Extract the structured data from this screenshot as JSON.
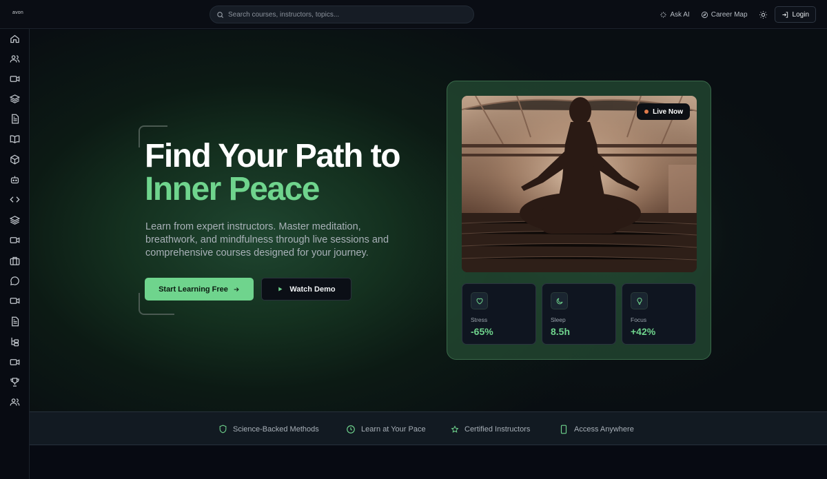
{
  "app": {
    "logo": "avon"
  },
  "search": {
    "placeholder": "Search courses, instructors, topics..."
  },
  "topnav": {
    "ask_ai": "Ask AI",
    "career_map": "Career Map",
    "login": "Login"
  },
  "sidebar": {
    "items": [
      {
        "icon": "home-icon"
      },
      {
        "icon": "users-icon"
      },
      {
        "icon": "video-icon"
      },
      {
        "icon": "layers-icon"
      },
      {
        "icon": "document-icon"
      },
      {
        "icon": "book-icon"
      },
      {
        "icon": "box-icon"
      },
      {
        "icon": "bot-icon"
      },
      {
        "icon": "code-icon"
      },
      {
        "icon": "layers-icon"
      },
      {
        "icon": "video-icon"
      },
      {
        "icon": "briefcase-icon"
      },
      {
        "icon": "chat-icon"
      },
      {
        "icon": "video-icon"
      },
      {
        "icon": "document-icon"
      },
      {
        "icon": "hierarchy-icon"
      },
      {
        "icon": "video-icon"
      },
      {
        "icon": "trophy-icon"
      },
      {
        "icon": "users-icon"
      }
    ]
  },
  "hero": {
    "title_line1": "Find Your Path to",
    "title_line2": "Inner Peace",
    "description": "Learn from expert instructors. Master meditation, breathwork, and mindfulness through live sessions and comprehensive courses designed for your journey.",
    "primary_cta": "Start Learning Free",
    "secondary_cta": "Watch Demo"
  },
  "card": {
    "badge": "Live Now",
    "stats": [
      {
        "icon": "heart-icon",
        "label": "Stress",
        "value": "-65%"
      },
      {
        "icon": "moon-icon",
        "label": "Sleep",
        "value": "8.5h"
      },
      {
        "icon": "lightbulb-icon",
        "label": "Focus",
        "value": "+42%"
      }
    ]
  },
  "features": [
    {
      "icon": "shield-icon",
      "label": "Science-Backed Methods"
    },
    {
      "icon": "clock-icon",
      "label": "Learn at Your Pace"
    },
    {
      "icon": "star-icon",
      "label": "Certified Instructors"
    },
    {
      "icon": "phone-icon",
      "label": "Access Anywhere"
    }
  ],
  "colors": {
    "accent": "#6fd48d",
    "background": "#070a12",
    "live_dot": "#e07b4b"
  }
}
